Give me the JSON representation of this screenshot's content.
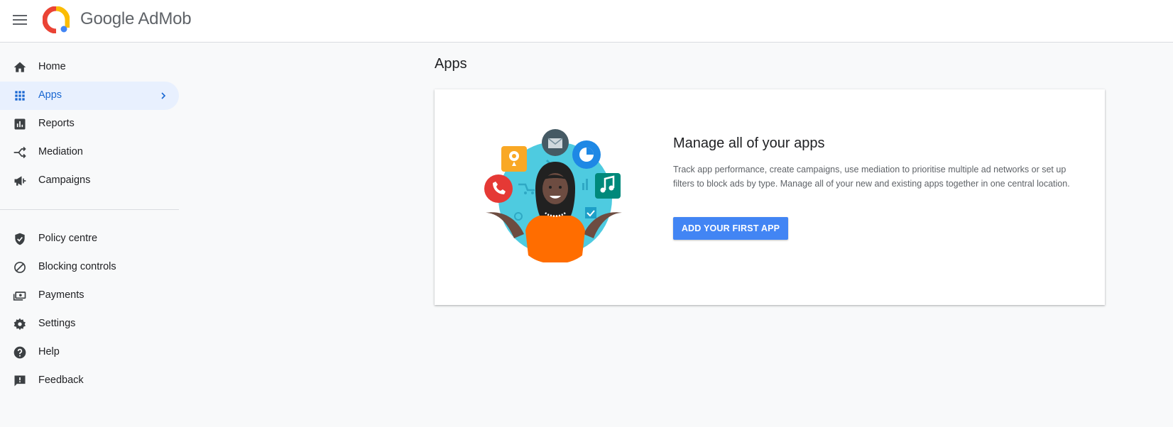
{
  "header": {
    "menu_icon": "hamburger-menu-icon",
    "logo_icon": "admob-logo-icon",
    "brand_google": "Google",
    "brand_product": "AdMob"
  },
  "sidebar": {
    "primary": [
      {
        "label": "Home",
        "icon": "home-icon"
      },
      {
        "label": "Apps",
        "icon": "apps-grid-icon",
        "active": true
      },
      {
        "label": "Reports",
        "icon": "reports-icon"
      },
      {
        "label": "Mediation",
        "icon": "mediation-icon"
      },
      {
        "label": "Campaigns",
        "icon": "megaphone-icon"
      }
    ],
    "secondary": [
      {
        "label": "Policy centre",
        "icon": "shield-check-icon"
      },
      {
        "label": "Blocking controls",
        "icon": "block-icon"
      },
      {
        "label": "Payments",
        "icon": "payments-icon"
      },
      {
        "label": "Settings",
        "icon": "gear-icon"
      },
      {
        "label": "Help",
        "icon": "help-icon"
      },
      {
        "label": "Feedback",
        "icon": "feedback-icon"
      }
    ]
  },
  "main": {
    "title": "Apps",
    "card": {
      "title": "Manage all of your apps",
      "description": "Track app performance, create campaigns, use mediation to prioritise multiple ad networks or set up filters to block ads by type. Manage all of your new and existing apps together in one central location.",
      "button_label": "ADD YOUR FIRST APP",
      "illustration": "woman-juggling-app-icons-illustration"
    }
  },
  "colors": {
    "accent": "#4285f4",
    "active_bg": "#e8f0fe",
    "active_text": "#1967d2",
    "page_bg": "#f8f9fa"
  }
}
